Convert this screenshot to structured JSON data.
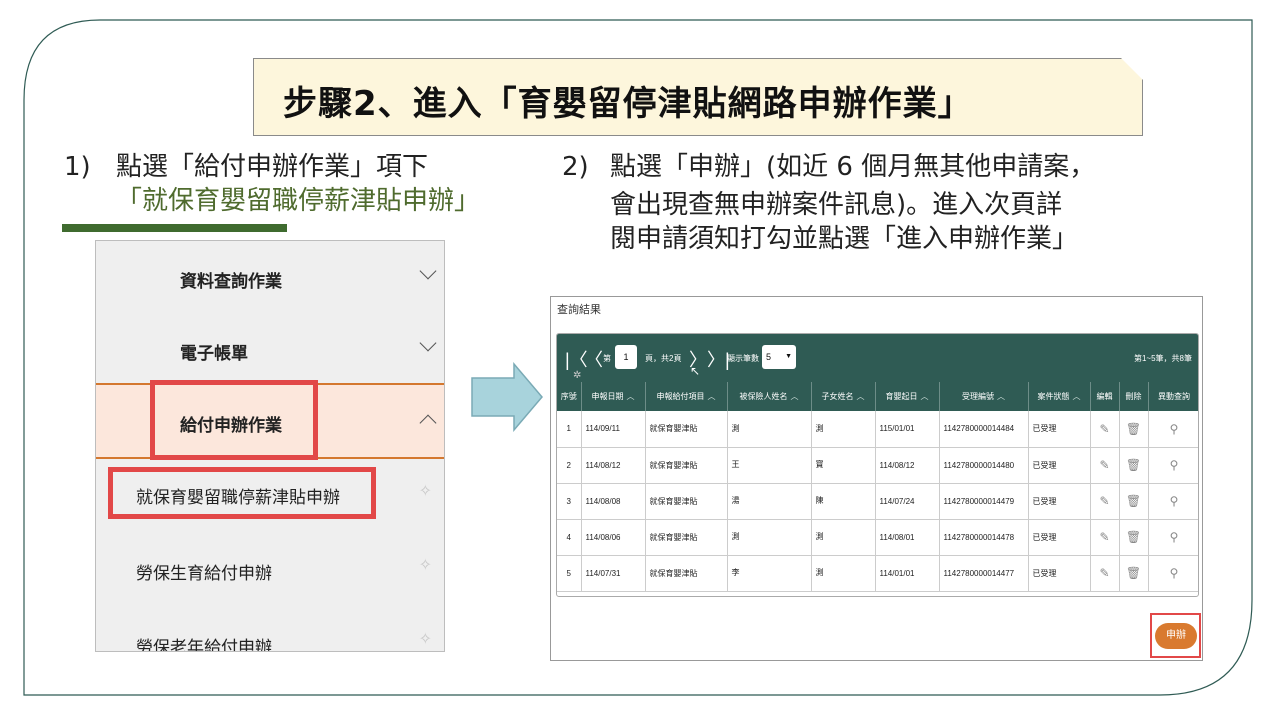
{
  "title": "步驟2、進入「育嬰留停津貼網路申辦作業」",
  "step1": {
    "num": "1)",
    "line1": "點選「給付申辦作業」項下",
    "line2": "「就保育嬰留職停薪津貼申辦」"
  },
  "step2": {
    "num": "2)",
    "line1": "點選「申辦」(如近 6 個月無其他申請案，",
    "line2": "會出現查無申辦案件訊息)。進入次頁詳",
    "line3": "閱申請須知打勾並點選「進入申辦作業」"
  },
  "menu": {
    "items": [
      {
        "label": "資料查詢作業"
      },
      {
        "label": "電子帳單"
      },
      {
        "label": "給付申辦作業"
      },
      {
        "label": "就保育嬰留職停薪津貼申辦"
      },
      {
        "label": "勞保生育給付申辦"
      },
      {
        "label": "勞保老年給付申辦"
      }
    ]
  },
  "screen": {
    "title": "查詢結果",
    "pager": {
      "first": "|〈",
      "prev": "〈",
      "prefix": "第",
      "page": "1",
      "suffix": "頁，共2頁",
      "next": "〉",
      "last": "〉|",
      "size_label": "顯示筆數",
      "size": "5",
      "summary": "第1~5筆，共8筆"
    },
    "headers": [
      "序號",
      "申報日期",
      "申報給付項目",
      "被保險人姓名",
      "子女姓名",
      "育嬰起日",
      "受理編號",
      "案件狀態",
      "編輯",
      "刪除",
      "異動查詢"
    ],
    "rows": [
      {
        "no": "1",
        "date": "114/09/11",
        "item": "就保育嬰津貼",
        "insured": "測",
        "child": "測",
        "start": "115/01/01",
        "case_no": "1142780000014484",
        "status": "已受理"
      },
      {
        "no": "2",
        "date": "114/08/12",
        "item": "就保育嬰津貼",
        "insured": "王",
        "child": "寶",
        "start": "114/08/12",
        "case_no": "1142780000014480",
        "status": "已受理"
      },
      {
        "no": "3",
        "date": "114/08/08",
        "item": "就保育嬰津貼",
        "insured": "湯",
        "child": "陳",
        "start": "114/07/24",
        "case_no": "1142780000014479",
        "status": "已受理"
      },
      {
        "no": "4",
        "date": "114/08/06",
        "item": "就保育嬰津貼",
        "insured": "測",
        "child": "測",
        "start": "114/08/01",
        "case_no": "1142780000014478",
        "status": "已受理"
      },
      {
        "no": "5",
        "date": "114/07/31",
        "item": "就保育嬰津貼",
        "insured": "李",
        "child": "測",
        "start": "114/01/01",
        "case_no": "1142780000014477",
        "status": "已受理"
      }
    ],
    "apply_label": "申辦"
  },
  "colors": {
    "header": "#2f5b54",
    "highlight": "#e24848",
    "accent": "#d97a2f",
    "title_bg": "#fdf6dc"
  }
}
